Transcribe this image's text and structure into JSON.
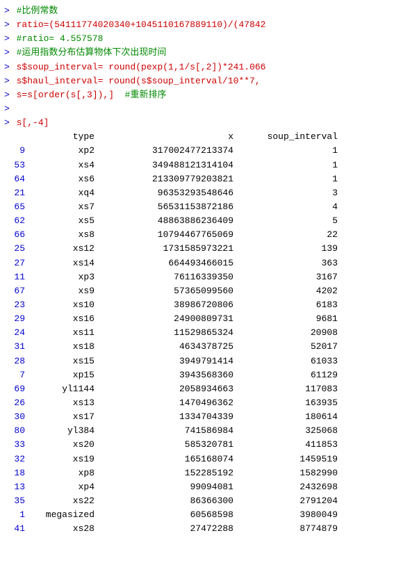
{
  "console": {
    "lines": [
      {
        "type": "comment",
        "prompt": ">",
        "text": " #比例常数"
      },
      {
        "type": "code",
        "prompt": ">",
        "text": " ratio=(54111774020340+1045110167889110)/(4784"
      },
      {
        "type": "code",
        "prompt": ">",
        "text": " #ratio= 4.557578"
      },
      {
        "type": "code",
        "prompt": ">",
        "text": " #运用指数分布估算物体下次出现时间"
      },
      {
        "type": "code",
        "prompt": ">",
        "text": " s$soup_interval= round(pexp(1,1/s[,2])*241.066"
      },
      {
        "type": "code",
        "prompt": ">",
        "text": " s$haul_interval= round(s$soup_interval/10**7,"
      },
      {
        "type": "code",
        "prompt": ">",
        "text": " s=s[order(s[,3]),]  #重新排序"
      },
      {
        "type": "blank",
        "prompt": ">",
        "text": ""
      },
      {
        "type": "code",
        "prompt": ">",
        "text": " s[,-4]"
      }
    ],
    "table_header": {
      "idx": "",
      "type": "type",
      "x": "x",
      "soup_interval": "soup_interval"
    },
    "table_rows": [
      {
        "idx": "9",
        "type": "xp2",
        "x": "317002477213374",
        "soup": "1"
      },
      {
        "idx": "53",
        "type": "xs4",
        "x": "349488121314104",
        "soup": "1"
      },
      {
        "idx": "64",
        "type": "xs6",
        "x": "213309779203821",
        "soup": "1"
      },
      {
        "idx": "21",
        "type": "xq4",
        "x": "96353293548646",
        "soup": "3"
      },
      {
        "idx": "65",
        "type": "xs7",
        "x": "56531153872186",
        "soup": "4"
      },
      {
        "idx": "62",
        "type": "xs5",
        "x": "48863886236409",
        "soup": "5"
      },
      {
        "idx": "66",
        "type": "xs8",
        "x": "10794467765069",
        "soup": "22"
      },
      {
        "idx": "25",
        "type": "xs12",
        "x": "1731585973221",
        "soup": "139"
      },
      {
        "idx": "27",
        "type": "xs14",
        "x": "664493466015",
        "soup": "363"
      },
      {
        "idx": "11",
        "type": "xp3",
        "x": "76116339350",
        "soup": "3167"
      },
      {
        "idx": "67",
        "type": "xs9",
        "x": "57365099560",
        "soup": "4202"
      },
      {
        "idx": "23",
        "type": "xs10",
        "x": "38986720806",
        "soup": "6183"
      },
      {
        "idx": "29",
        "type": "xs16",
        "x": "24900809731",
        "soup": "9681"
      },
      {
        "idx": "24",
        "type": "xs11",
        "x": "11529865324",
        "soup": "20908"
      },
      {
        "idx": "31",
        "type": "xs18",
        "x": "4634378725",
        "soup": "52017"
      },
      {
        "idx": "28",
        "type": "xs15",
        "x": "3949791414",
        "soup": "61033"
      },
      {
        "idx": "7",
        "type": "xp15",
        "x": "3943568360",
        "soup": "61129"
      },
      {
        "idx": "69",
        "type": "yl1144",
        "x": "2058934663",
        "soup": "117083"
      },
      {
        "idx": "26",
        "type": "xs13",
        "x": "1470496362",
        "soup": "163935"
      },
      {
        "idx": "30",
        "type": "xs17",
        "x": "1334704339",
        "soup": "180614"
      },
      {
        "idx": "80",
        "type": "yl384",
        "x": "741586984",
        "soup": "325068"
      },
      {
        "idx": "33",
        "type": "xs20",
        "x": "585320781",
        "soup": "411853"
      },
      {
        "idx": "32",
        "type": "xs19",
        "x": "165168074",
        "soup": "1459519"
      },
      {
        "idx": "18",
        "type": "xp8",
        "x": "152285192",
        "soup": "1582990"
      },
      {
        "idx": "13",
        "type": "xp4",
        "x": "99094081",
        "soup": "2432698"
      },
      {
        "idx": "35",
        "type": "xs22",
        "x": "86366300",
        "soup": "2791204"
      },
      {
        "idx": "1",
        "type": "megasized",
        "x": "60568598",
        "soup": "3980049"
      },
      {
        "idx": "41",
        "type": "xs28",
        "x": "27472288",
        "soup": "8774879"
      }
    ]
  }
}
